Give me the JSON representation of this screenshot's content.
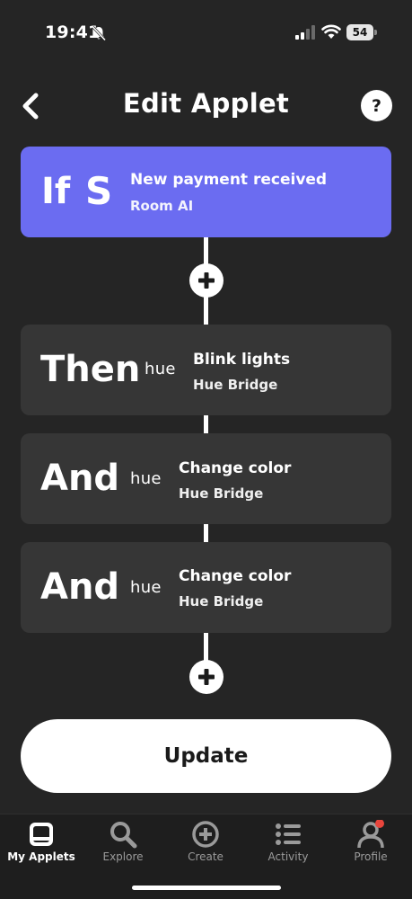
{
  "status_bar": {
    "time": "19:41",
    "battery": "54",
    "icons": [
      "bell-slash-icon",
      "cellular-signal-icon",
      "wifi-icon",
      "battery-icon"
    ]
  },
  "header": {
    "back_icon": "chevron-left-icon",
    "title": "Edit Applet",
    "help_label": "?"
  },
  "trigger": {
    "keyword": "If",
    "service_letter": "S",
    "title": "New payment received",
    "subtitle": "Room AI",
    "color": "#6b6cf1"
  },
  "actions": [
    {
      "keyword": "Then",
      "service_logo": "hue",
      "title": "Blink lights",
      "subtitle": "Hue Bridge"
    },
    {
      "keyword": "And",
      "service_logo": "hue",
      "title": "Change color",
      "subtitle": "Hue Bridge"
    },
    {
      "keyword": "And",
      "service_logo": "hue",
      "title": "Change color",
      "subtitle": "Hue Bridge"
    }
  ],
  "update_label": "Update",
  "tabs": [
    {
      "label": "My Applets",
      "icon": "my-applets-icon",
      "active": true
    },
    {
      "label": "Explore",
      "icon": "search-icon",
      "active": false
    },
    {
      "label": "Create",
      "icon": "plus-circle-icon",
      "active": false
    },
    {
      "label": "Activity",
      "icon": "list-icon",
      "active": false
    },
    {
      "label": "Profile",
      "icon": "person-icon",
      "active": false,
      "badge_color": "#e8453c"
    }
  ]
}
